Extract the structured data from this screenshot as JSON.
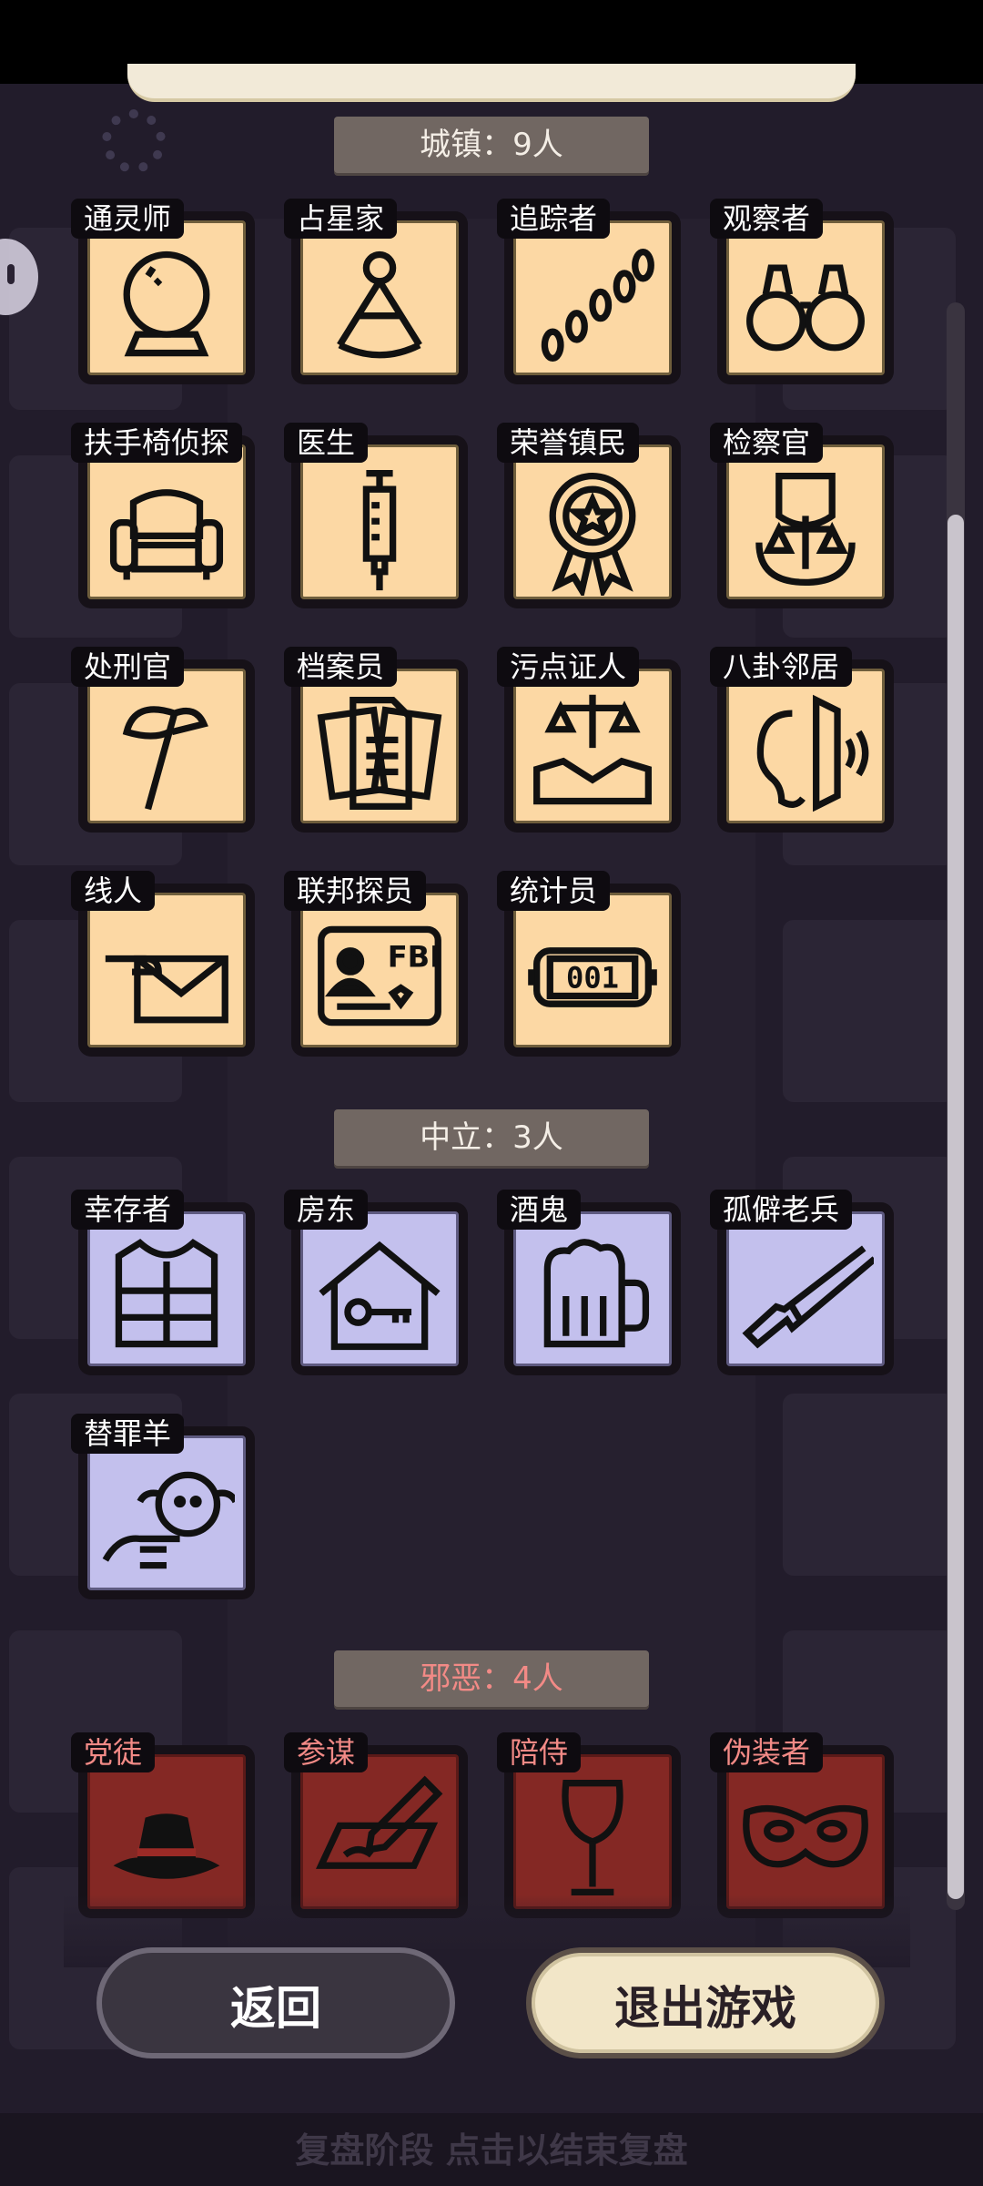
{
  "sections": [
    {
      "title": "城镇：9人",
      "style": "town"
    },
    {
      "title": "中立：3人",
      "style": "neutral"
    },
    {
      "title": "邪恶：4人",
      "style": "evil"
    }
  ],
  "roles": {
    "town": [
      {
        "name": "通灵师",
        "icon": "crystal-ball-icon"
      },
      {
        "name": "占星家",
        "icon": "sextant-icon"
      },
      {
        "name": "追踪者",
        "icon": "footprints-icon"
      },
      {
        "name": "观察者",
        "icon": "binoculars-icon"
      },
      {
        "name": "扶手椅侦探",
        "icon": "armchair-icon"
      },
      {
        "name": "医生",
        "icon": "syringe-icon"
      },
      {
        "name": "荣誉镇民",
        "icon": "medal-icon"
      },
      {
        "name": "检察官",
        "icon": "scales-emblem-icon"
      },
      {
        "name": "处刑官",
        "icon": "axe-icon"
      },
      {
        "name": "档案员",
        "icon": "documents-icon"
      },
      {
        "name": "污点证人",
        "icon": "handshake-scales-icon"
      },
      {
        "name": "八卦邻居",
        "icon": "ear-wall-icon"
      },
      {
        "name": "线人",
        "icon": "envelope-hand-icon"
      },
      {
        "name": "联邦探员",
        "icon": "fbi-badge-icon"
      },
      {
        "name": "统计员",
        "icon": "counter-icon"
      }
    ],
    "neutral": [
      {
        "name": "幸存者",
        "icon": "vest-icon"
      },
      {
        "name": "房东",
        "icon": "house-key-icon"
      },
      {
        "name": "酒鬼",
        "icon": "beer-mug-icon"
      },
      {
        "name": "孤僻老兵",
        "icon": "rifle-icon"
      },
      {
        "name": "替罪羊",
        "icon": "sheep-point-icon"
      }
    ],
    "evil": [
      {
        "name": "党徒",
        "icon": "fedora-icon"
      },
      {
        "name": "参谋",
        "icon": "pen-paper-icon"
      },
      {
        "name": "陪侍",
        "icon": "wine-glass-icon"
      },
      {
        "name": "伪装者",
        "icon": "mask-icon"
      }
    ]
  },
  "counter_digits": "001",
  "fbi_text": "FBI",
  "buttons": {
    "back": "返回",
    "exit": "退出游戏"
  },
  "footer_hint": "复盘阶段 点击以结束复盘",
  "colors": {
    "town": "#fcd8a4",
    "neutral": "#c3c0ed",
    "evil": "#842824",
    "header": "#716762"
  }
}
